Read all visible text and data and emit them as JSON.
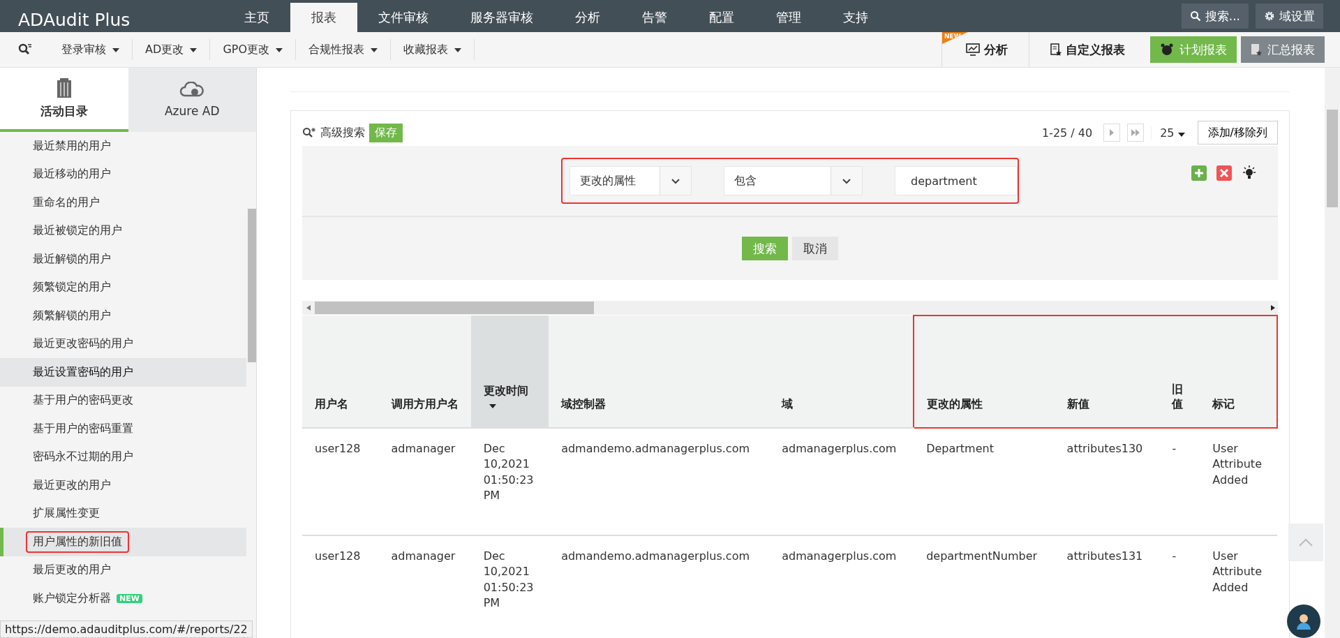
{
  "app": {
    "logo": "ADAudit Plus"
  },
  "nav": {
    "tabs": [
      {
        "label": "主页",
        "selected": false
      },
      {
        "label": "报表",
        "selected": true
      },
      {
        "label": "文件审核",
        "selected": false
      },
      {
        "label": "服务器审核",
        "selected": false
      },
      {
        "label": "分析",
        "selected": false
      },
      {
        "label": "告警",
        "selected": false
      },
      {
        "label": "配置",
        "selected": false
      },
      {
        "label": "管理",
        "selected": false
      },
      {
        "label": "支持",
        "selected": false
      }
    ],
    "search_button": "搜索...",
    "domain_settings": "域设置"
  },
  "subnav": {
    "menus": [
      "登录审核",
      "AD更改",
      "GPO更改",
      "合规性报表",
      "收藏报表"
    ],
    "analysis": {
      "badge": "NEW",
      "label": "分析"
    },
    "custom_reports": "自定义报表",
    "schedule_reports": "计划报表",
    "summary_reports": "汇总报表"
  },
  "sidebar": {
    "tabs": [
      {
        "label": "活动目录",
        "selected": true
      },
      {
        "label": "Azure AD",
        "selected": false
      }
    ],
    "items": [
      {
        "label": "最近禁用的用户",
        "selected": false,
        "hovered": false
      },
      {
        "label": "最近移动的用户",
        "selected": false,
        "hovered": false
      },
      {
        "label": "重命名的用户",
        "selected": false,
        "hovered": false
      },
      {
        "label": "最近被锁定的用户",
        "selected": false,
        "hovered": false
      },
      {
        "label": "最近解锁的用户",
        "selected": false,
        "hovered": false
      },
      {
        "label": "频繁锁定的用户",
        "selected": false,
        "hovered": false
      },
      {
        "label": "频繁解锁的用户",
        "selected": false,
        "hovered": false
      },
      {
        "label": "最近更改密码的用户",
        "selected": false,
        "hovered": false
      },
      {
        "label": "最近设置密码的用户",
        "selected": false,
        "hovered": true
      },
      {
        "label": "基于用户的密码更改",
        "selected": false,
        "hovered": false
      },
      {
        "label": "基于用户的密码重置",
        "selected": false,
        "hovered": false
      },
      {
        "label": "密码永不过期的用户",
        "selected": false,
        "hovered": false
      },
      {
        "label": "最近更改的用户",
        "selected": false,
        "hovered": false
      },
      {
        "label": "扩展属性变更",
        "selected": false,
        "hovered": false
      },
      {
        "label": "用户属性的新旧值",
        "selected": true,
        "hovered": false
      },
      {
        "label": "最后更改的用户",
        "selected": false,
        "hovered": false
      },
      {
        "label": "账户锁定分析器",
        "selected": false,
        "hovered": false,
        "badge": "NEW"
      }
    ]
  },
  "status_url": "https://demo.adauditplus.com/#/reports/22",
  "search_panel": {
    "title": "高级搜索",
    "save": "保存",
    "pagination": "1-25 / 40",
    "page_size": "25",
    "add_remove_columns": "添加/移除列",
    "filter": {
      "field": "更改的属性",
      "operator": "包含",
      "value": "department"
    },
    "search": "搜索",
    "cancel": "取消"
  },
  "table": {
    "columns": [
      {
        "label": "用户名",
        "sorted": false
      },
      {
        "label": "调用方用户名",
        "sorted": false
      },
      {
        "label": "更改时间",
        "sorted": true
      },
      {
        "label": "域控制器",
        "sorted": false
      },
      {
        "label": "域",
        "sorted": false
      },
      {
        "label": "更改的属性",
        "sorted": false
      },
      {
        "label": "新值",
        "sorted": false
      },
      {
        "label": "旧值",
        "sorted": false
      },
      {
        "label": "标记",
        "sorted": false
      }
    ],
    "rows": [
      [
        "user128",
        "admanager",
        "Dec 10,2021 01:50:23 PM",
        "admandemo.admanagerplus.com",
        "admanagerplus.com",
        "Department",
        "attributes130",
        "-",
        "User Attribute Added"
      ],
      [
        "user128",
        "admanager",
        "Dec 10,2021 01:50:23 PM",
        "admandemo.admanagerplus.com",
        "admanagerplus.com",
        "departmentNumber",
        "attributes131",
        "-",
        "User Attribute Added"
      ]
    ]
  }
}
